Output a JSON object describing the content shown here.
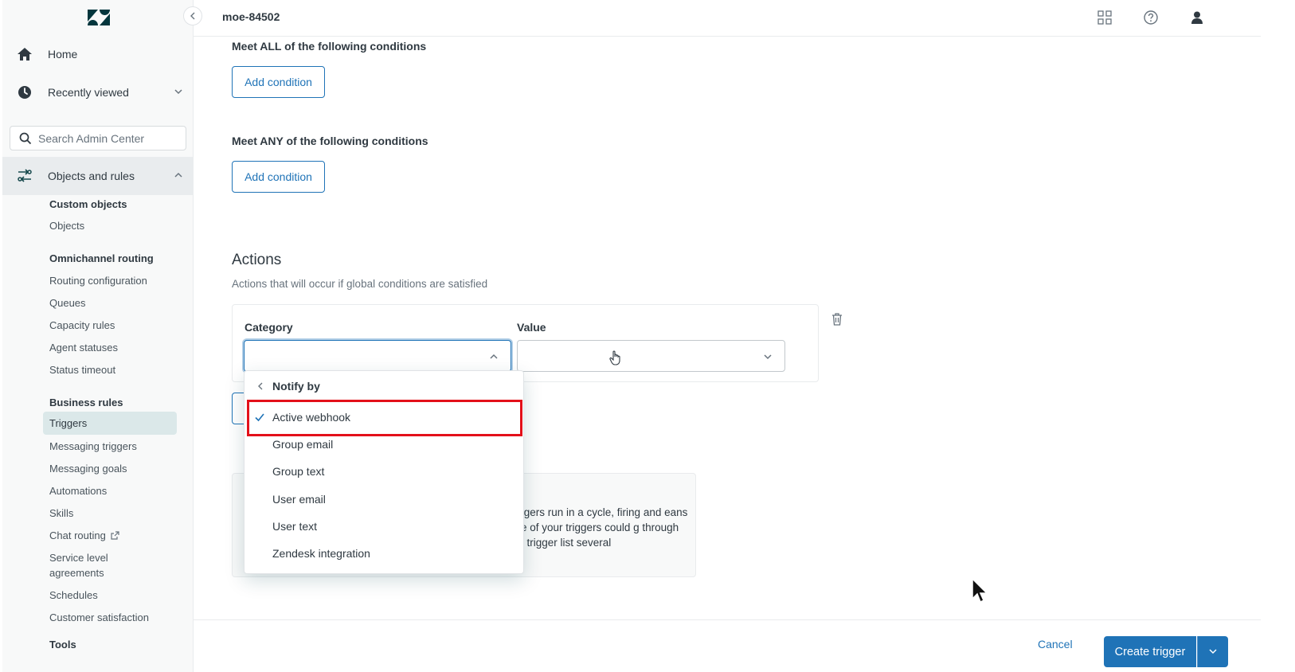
{
  "topbar": {
    "account": "moe-84502"
  },
  "sidebar": {
    "nav": [
      {
        "label": "Home"
      },
      {
        "label": "Recently viewed"
      },
      {
        "label": "Objects and rules"
      }
    ],
    "search_placeholder": "Search Admin Center",
    "groups": {
      "custom_objects": {
        "heading": "Custom objects",
        "items": [
          "Objects"
        ]
      },
      "omnichannel": {
        "heading": "Omnichannel routing",
        "items": [
          "Routing configuration",
          "Queues",
          "Capacity rules",
          "Agent statuses",
          "Status timeout"
        ]
      },
      "business_rules": {
        "heading": "Business rules",
        "items": [
          "Triggers",
          "Messaging triggers",
          "Messaging goals",
          "Automations",
          "Skills",
          "Chat routing",
          "Service level",
          "agreements",
          "Schedules",
          "Customer satisfaction"
        ]
      },
      "tools": {
        "heading": "Tools"
      }
    }
  },
  "main": {
    "all_conditions_label": "Meet ALL of the following conditions",
    "any_conditions_label": "Meet ANY of the following conditions",
    "add_condition": "Add condition",
    "actions_heading": "Actions",
    "actions_sub": "Actions that will occur if global conditions are satisfied",
    "category_label": "Category",
    "value_label": "Value",
    "info_text": "triggers run in a cycle, firing and eans one of your triggers could g through the trigger list several"
  },
  "dropdown": {
    "back_label": "Notify by",
    "items": [
      "Active webhook",
      "Group email",
      "Group text",
      "User email",
      "User text",
      "Zendesk integration"
    ],
    "selected": "Active webhook"
  },
  "footer": {
    "cancel": "Cancel",
    "create": "Create trigger"
  },
  "colors": {
    "brand_blue": "#1f73b7",
    "highlight_red": "#e3101a",
    "selected_nav": "#dbe8e9"
  }
}
